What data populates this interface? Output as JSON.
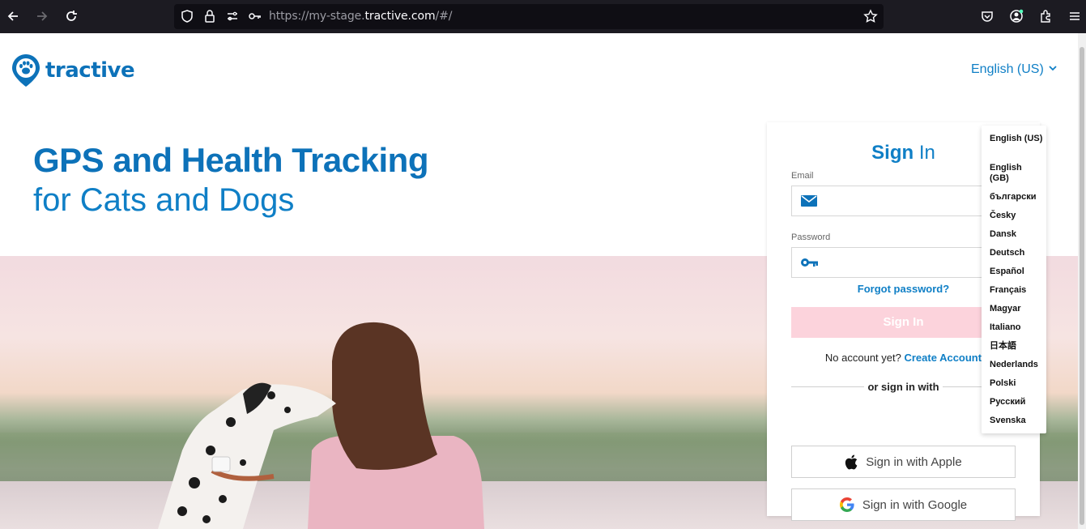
{
  "browser": {
    "url_prefix": "https://my-stage.",
    "url_host": "tractive.com",
    "url_suffix": "/#/"
  },
  "header": {
    "logo_text": "tractive",
    "language_selected": "English (US)"
  },
  "hero": {
    "line1": "GPS and Health Tracking",
    "line2": "for Cats and Dogs"
  },
  "signin": {
    "title_bold": "Sign",
    "title_rest": " In",
    "email_label": "Email",
    "password_label": "Password",
    "forgot": "Forgot password?",
    "button": "Sign In",
    "no_account": "No account yet?",
    "create_account": "Create Account",
    "or_sign_in_with": "or sign in with",
    "apple": "Sign in with Apple",
    "google": "Sign in with Google"
  },
  "languages": [
    "English (US)",
    "English (GB)",
    "български",
    "Česky",
    "Dansk",
    "Deutsch",
    "Español",
    "Français",
    "Magyar",
    "Italiano",
    "日本語",
    "Nederlands",
    "Polski",
    "Русский",
    "Svenska"
  ],
  "colors": {
    "brand_blue": "#0f7fc6",
    "brand_dark_blue": "#0d72b9",
    "signin_button_disabled": "#fcd3dc"
  }
}
